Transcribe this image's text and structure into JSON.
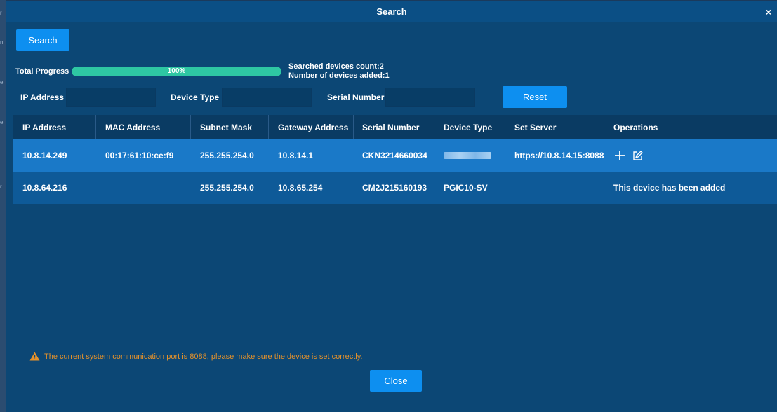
{
  "background_strip": [
    "r",
    "n",
    "e",
    "e",
    "r"
  ],
  "dialog": {
    "title": "Search",
    "close_glyph": "×"
  },
  "toolbar": {
    "search_label": "Search"
  },
  "progress": {
    "label": "Total Progress",
    "value_percent": 100,
    "value_text": "100%"
  },
  "stats": {
    "searched": "Searched devices count:2",
    "added": "Number of devices added:1"
  },
  "filters": {
    "ip_label": "IP Address",
    "ip_value": "",
    "device_type_label": "Device Type",
    "device_type_value": "",
    "serial_label": "Serial Number",
    "serial_value": "",
    "reset_label": "Reset"
  },
  "table": {
    "columns": [
      "IP Address",
      "MAC Address",
      "Subnet Mask",
      "Gateway Address",
      "Serial Number",
      "Device Type",
      "Set Server",
      "Operations"
    ],
    "rows": [
      {
        "ip": "10.8.14.249",
        "mac": "00:17:61:10:ce:f9",
        "subnet": "255.255.254.0",
        "gateway": "10.8.14.1",
        "serial": "CKN3214660034",
        "device_type": "",
        "server": "https://10.8.14.15:8088",
        "operations": ""
      },
      {
        "ip": "10.8.64.216",
        "mac": "",
        "subnet": "255.255.254.0",
        "gateway": "10.8.65.254",
        "serial": "CM2J215160193",
        "device_type": "PGIC10-SV",
        "server": "",
        "operations": "This device has been added"
      }
    ]
  },
  "warning": {
    "icon": "warning-triangle-icon",
    "text": "The current system communication port is 8088, please make sure the device is set correctly."
  },
  "footer": {
    "close_label": "Close"
  },
  "colors": {
    "dialog_bg": "#0c4775",
    "primary_button": "#0d8ff0",
    "progress_fill": "#2ec7a3",
    "selected_row": "#1a79c8",
    "warning": "#e6922a"
  }
}
